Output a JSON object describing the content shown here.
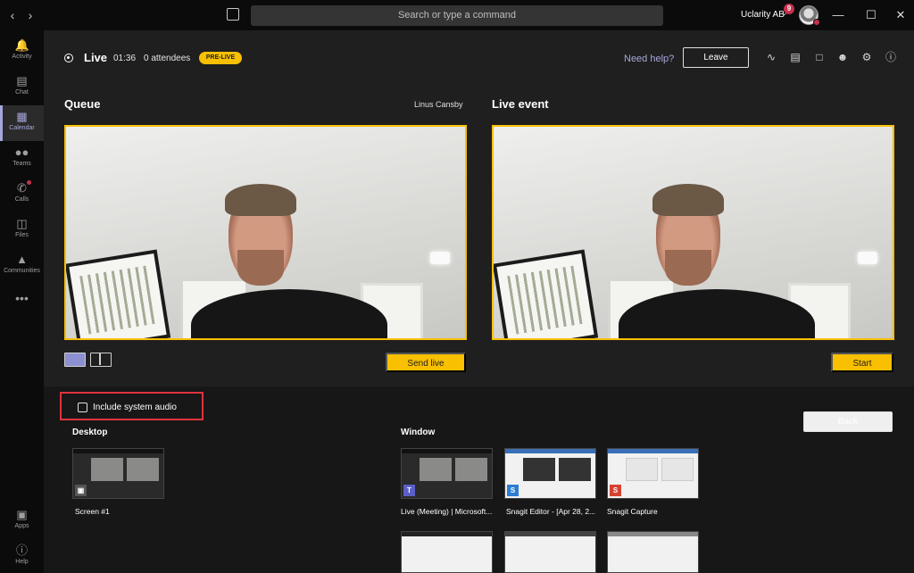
{
  "titlebar": {
    "search_placeholder": "Search or type a command",
    "org_name": "Uclarity AB",
    "notification_count": "9"
  },
  "rail": {
    "items": [
      {
        "label": "Activity",
        "icon": "bell-icon",
        "active": false
      },
      {
        "label": "Chat",
        "icon": "chat-icon",
        "active": false
      },
      {
        "label": "Calendar",
        "icon": "calendar-icon",
        "active": true
      },
      {
        "label": "Teams",
        "icon": "teams-icon",
        "active": false
      },
      {
        "label": "Calls",
        "icon": "phone-icon",
        "active": false
      },
      {
        "label": "Files",
        "icon": "file-icon",
        "active": false
      },
      {
        "label": "Communities",
        "icon": "communities-icon",
        "active": false
      },
      {
        "label": "Apps",
        "icon": "apps-icon",
        "active": false
      },
      {
        "label": "Help",
        "icon": "help-icon",
        "active": false
      }
    ]
  },
  "live": {
    "label": "Live",
    "time": "01:36",
    "attendees": "0 attendees",
    "badge": "PRE-LIVE",
    "need_help": "Need help?",
    "leave": "Leave"
  },
  "queue": {
    "title": "Queue",
    "presenter": "Linus Cansby",
    "send_live": "Send live"
  },
  "live_event": {
    "title": "Live event",
    "start": "Start"
  },
  "share": {
    "include_audio": "Include system audio",
    "back": "Back",
    "desktop_title": "Desktop",
    "window_title": "Window",
    "desktop_items": [
      {
        "label": "Screen #1"
      }
    ],
    "window_items": [
      {
        "label": "Live (Meeting) | Microsoft..."
      },
      {
        "label": "Snagit Editor - [Apr 28, 2..."
      },
      {
        "label": "Snagit Capture"
      }
    ]
  },
  "colors": {
    "accent_yellow": "#f8c000",
    "accent_purple": "#a6a7dc",
    "highlight_red": "#e0323c"
  }
}
